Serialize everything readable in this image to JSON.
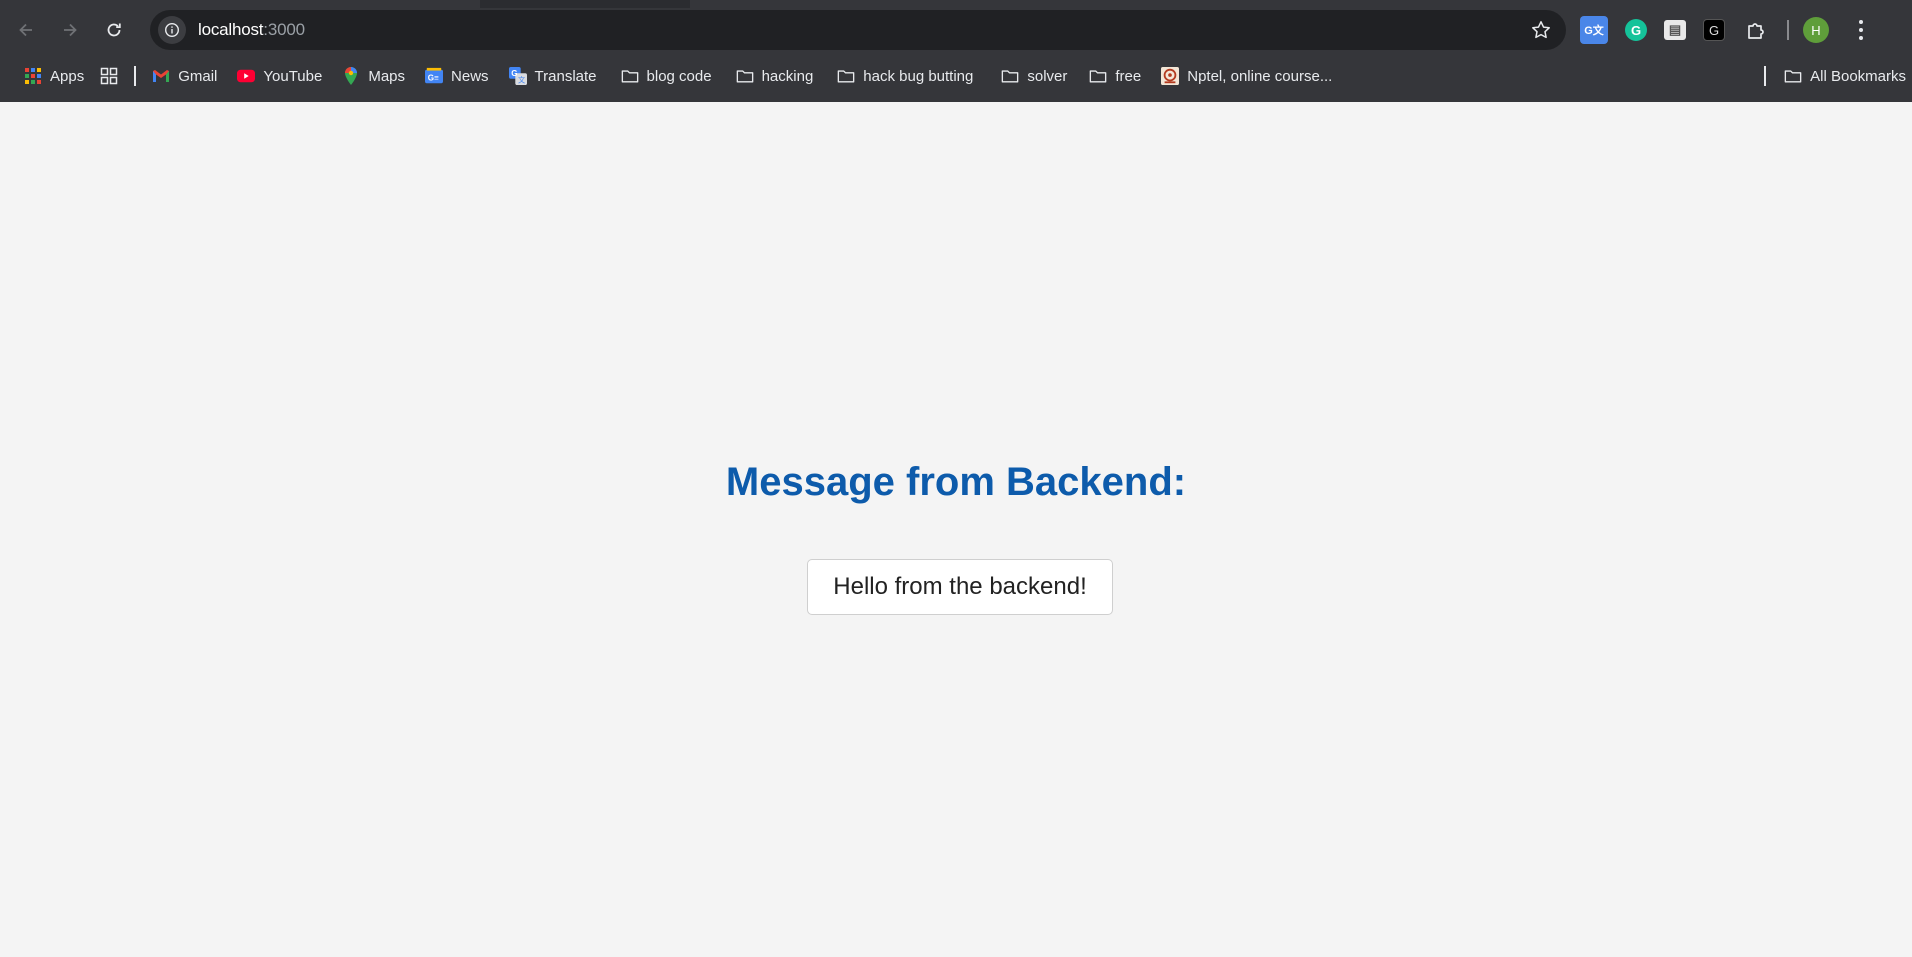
{
  "browser": {
    "url_host": "localhost",
    "url_port": ":3000",
    "profile_initial": "H",
    "icons": {
      "back": "back-arrow-icon",
      "forward": "forward-arrow-icon",
      "reload": "reload-icon",
      "site_info": "info-icon",
      "bookmark_star": "star-icon",
      "extensions": "puzzle-icon",
      "menu": "three-dots-icon"
    },
    "extensions": [
      {
        "name": "google-translate-extension",
        "glyph": "G文"
      },
      {
        "name": "grammarly-extension",
        "glyph": "G"
      },
      {
        "name": "printer-extension",
        "glyph": "▤"
      },
      {
        "name": "g-extension",
        "glyph": "G"
      }
    ]
  },
  "bookmarks": {
    "items": [
      {
        "label": "Apps",
        "icon": "apps-grid-icon"
      },
      {
        "label": "",
        "icon": "grid-icon"
      },
      {
        "label": "Gmail",
        "icon": "gmail-icon"
      },
      {
        "label": "YouTube",
        "icon": "youtube-icon"
      },
      {
        "label": "Maps",
        "icon": "maps-pin-icon"
      },
      {
        "label": "News",
        "icon": "news-icon"
      },
      {
        "label": "Translate",
        "icon": "translate-icon"
      },
      {
        "label": "blog code",
        "icon": "folder-icon"
      },
      {
        "label": "hacking",
        "icon": "folder-icon"
      },
      {
        "label": "hack bug butting",
        "icon": "folder-icon"
      },
      {
        "label": "solver",
        "icon": "folder-icon"
      },
      {
        "label": "free",
        "icon": "folder-icon"
      },
      {
        "label": "Nptel, online course...",
        "icon": "nptel-icon"
      }
    ],
    "all_bookmarks": "All Bookmarks"
  },
  "page": {
    "heading": "Message from Backend:",
    "message": "Hello from the backend!",
    "heading_color": "#0d5bab",
    "background_color": "#f4f4f4"
  }
}
